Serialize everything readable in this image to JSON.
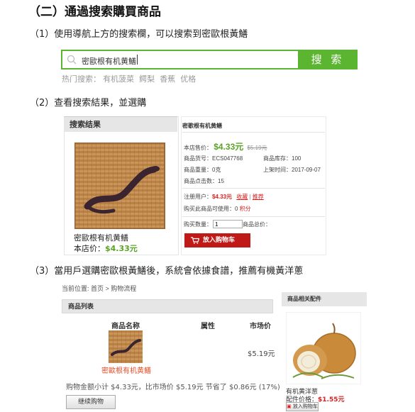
{
  "section_title": "（二）通過搜索購買商品",
  "step1": "（1）使用導航上方的搜索欄，可以搜索到密歐根黃鱔",
  "step2": "（2）查看搜索結果，並選購",
  "step3": "（3）當用戶選購密歐根黃鱔後，系統會依據食譜，推薦有機黃洋蔥",
  "search": {
    "value": "密歐根有机黄鱔",
    "button": "搜 索",
    "hot_label": "热门搜索：",
    "hot_items": [
      "有机菠菜",
      "鳄梨",
      "香蕉",
      "优格"
    ]
  },
  "result": {
    "header": "搜索结果",
    "product_name": "密歐根有机黄鳝",
    "price_label": "本店价：",
    "price": "$4.33元",
    "detail": {
      "title": "密歌根有机黄鳝",
      "shop_price_label": "本店售价：",
      "shop_price": "$4.33元",
      "market_price": "$5.19元",
      "sku_label": "商品货号：",
      "sku": "ECS047768",
      "stock_label": "商品库存：",
      "stock": "100",
      "weight_label": "商品重量：",
      "weight": "0克",
      "listed_label": "上架时间：",
      "listed": "2017-09-07",
      "clicks_label": "商品点击数：",
      "clicks": "15",
      "member_label": "注册用户：",
      "member_price": "$4.33元",
      "favorite": "收藏",
      "recommend": "推荐",
      "points_label": "购买此商品可使用：",
      "points": "0",
      "points_unit": "积分",
      "qty_label": "购买数量：",
      "qty": "1",
      "total_label": "商品总价：",
      "cart_button": "放入购物车"
    }
  },
  "cart": {
    "breadcrumb": "当前位置: 首页 > 购物流程",
    "list_header": "商品列表",
    "cols": [
      "商品名称",
      "属性",
      "市场价"
    ],
    "item_name": "密歐根有机黄鳝",
    "item_market_price": "$5.19元",
    "summary": "购物金额小计 $4.33元，比市场价 $5.19元 节省了 $0.86元 (17%)",
    "continue_button": "继续购物"
  },
  "related": {
    "header": "商品相关配件",
    "name": "有机黄洋葱",
    "price_label": "配件价格：",
    "price": "$1.55元",
    "add_label": "放入购物车"
  },
  "colors": {
    "accent_green": "#5cb531",
    "price_green": "#5aa425",
    "red": "#d92020",
    "cart_red": "#c01a18"
  }
}
